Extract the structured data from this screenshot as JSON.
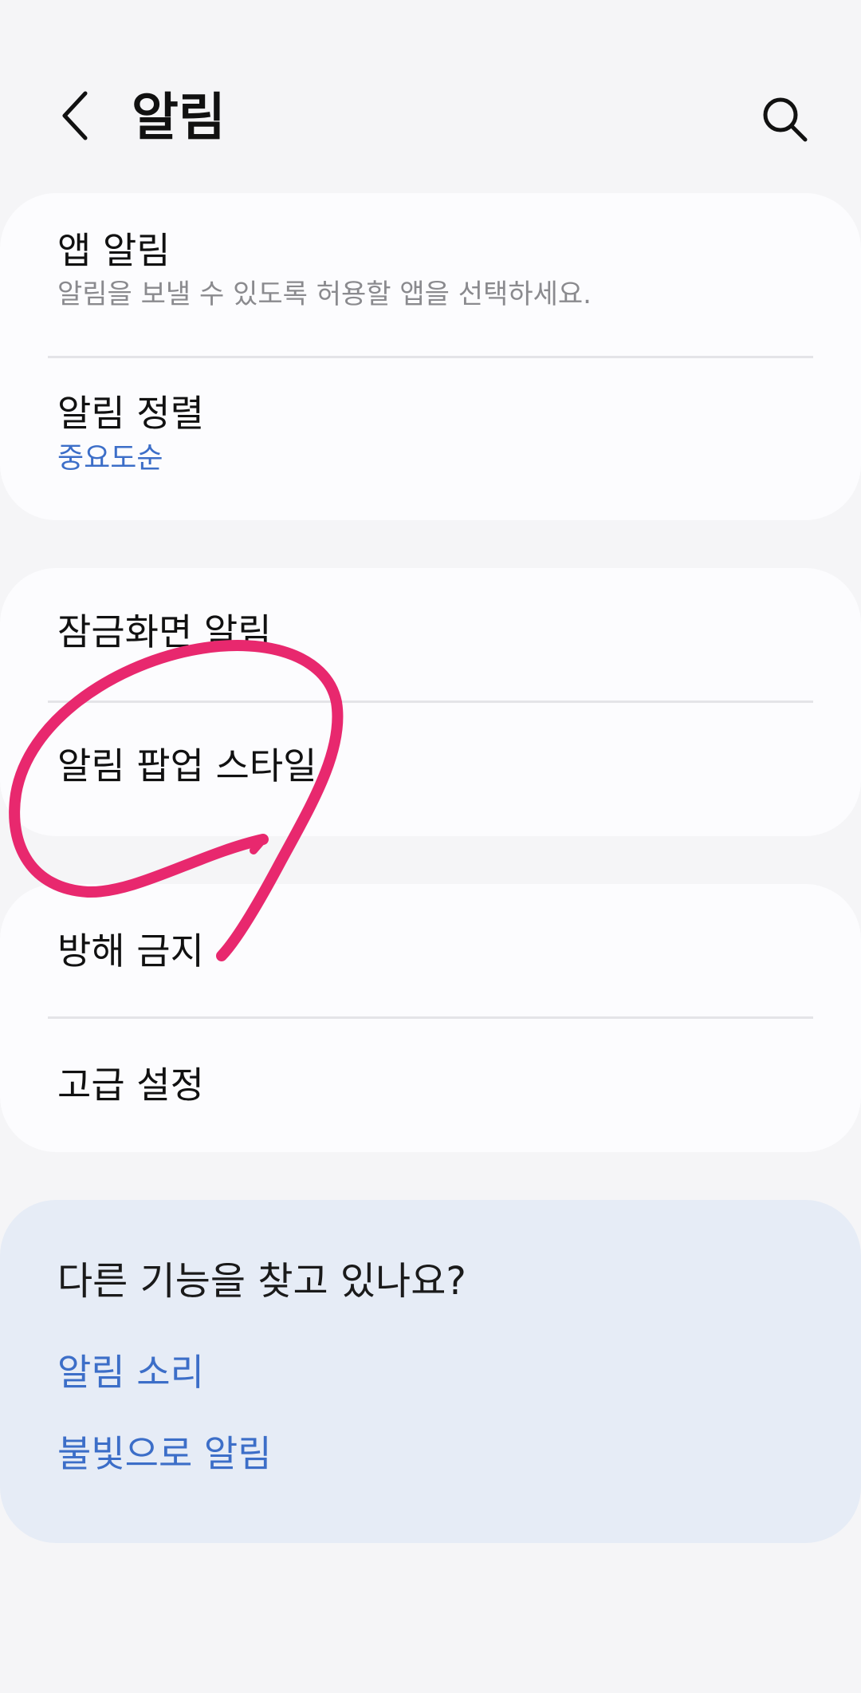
{
  "header": {
    "title": "알림",
    "back_icon": "back-arrow-icon",
    "search_icon": "search-icon"
  },
  "card1": {
    "items": [
      {
        "title": "앱 알림",
        "subtitle": "알림을 보낼 수 있도록 허용할 앱을 선택하세요."
      },
      {
        "title": "알림 정렬",
        "value": "중요도순"
      }
    ]
  },
  "card2": {
    "items": [
      {
        "title": "잠금화면 알림"
      },
      {
        "title": "알림 팝업 스타일"
      }
    ]
  },
  "card3": {
    "items": [
      {
        "title": "방해 금지"
      },
      {
        "title": "고급 설정"
      }
    ]
  },
  "suggestions": {
    "title": "다른 기능을 찾고 있나요?",
    "links": [
      "알림 소리",
      "불빛으로 알림"
    ]
  },
  "colors": {
    "accent": "#3c6ec8",
    "annotation": "#e8286e",
    "background": "#f5f5f7",
    "card": "#fcfcfe",
    "suggest_card": "#e6ecf6"
  }
}
